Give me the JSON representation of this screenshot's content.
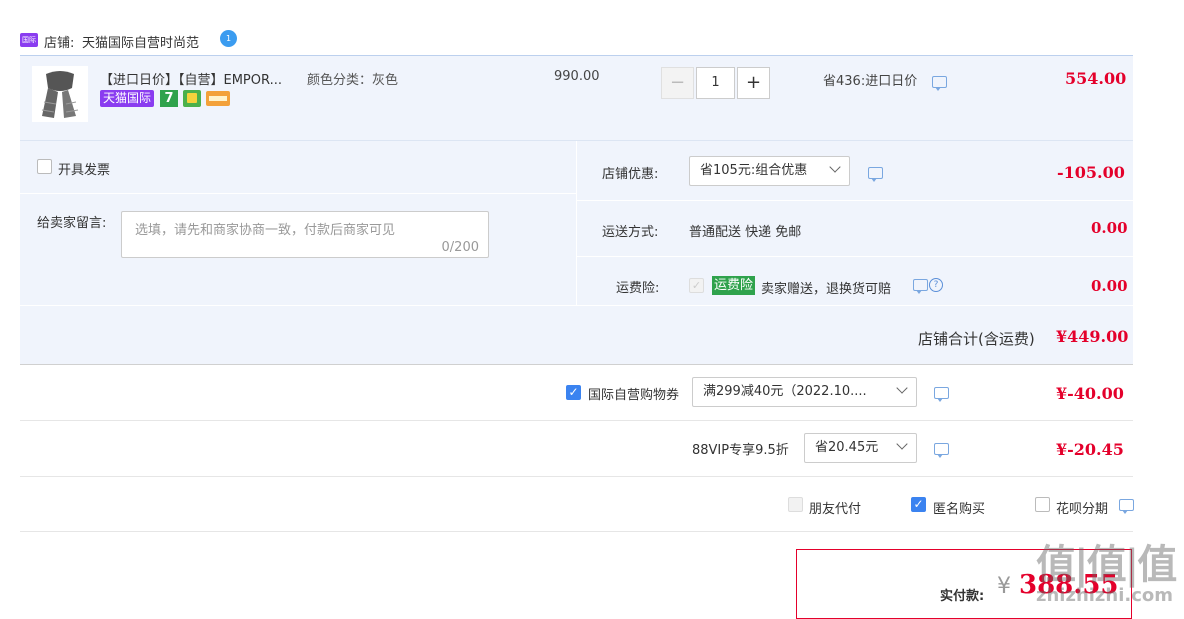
{
  "shop": {
    "label": "店铺:",
    "name": "天猫国际自营时尚范"
  },
  "item": {
    "title": "【进口日价】【自营】EMPOR...",
    "sku": "颜色分类：灰色",
    "badge_tmall": "天猫国际",
    "badge_7": "7",
    "orig_price": "990.00",
    "qty": "1",
    "minus": "−",
    "plus": "+",
    "saving": "省436:进口日价",
    "price": "554.00"
  },
  "invoice": {
    "label": "开具发票"
  },
  "message": {
    "label": "给卖家留言:",
    "placeholder": "选填，请先和商家协商一致，付款后商家可见",
    "counter": "0/200"
  },
  "shop_discount": {
    "label": "店铺优惠:",
    "value": "省105元:组合优惠",
    "amount": "-105.00"
  },
  "shipping": {
    "label": "运送方式:",
    "value": "普通配送 快递 免邮",
    "amount": "0.00"
  },
  "insurance": {
    "label": "运费险:",
    "tag": "运费险",
    "desc": "卖家赠送，退换货可赔",
    "help": "?",
    "amount": "0.00"
  },
  "shop_total": {
    "label": "店铺合计(含运费)",
    "amount": "¥449.00"
  },
  "coupon": {
    "label": "国际自营购物券",
    "value": "满299减40元（2022.10....",
    "amount": "¥-40.00"
  },
  "vip": {
    "label": "88VIP专享9.5折",
    "value": "省20.45元",
    "amount": "¥-20.45"
  },
  "options": {
    "friend_pay": "朋友代付",
    "anonymous": "匿名购买",
    "huabei": "花呗分期"
  },
  "payment": {
    "label": "实付款:",
    "currency": "¥",
    "amount": "388.55"
  },
  "watermark": {
    "logo": "值|值|值",
    "domain": "zhizhizhi.com"
  },
  "colors": {
    "accent_red": "#e4002b",
    "panel_blue": "#f0f4fc",
    "check_blue": "#3b83f0",
    "tag_green": "#2fa24c",
    "tmall_purple": "#8a3cf0"
  }
}
